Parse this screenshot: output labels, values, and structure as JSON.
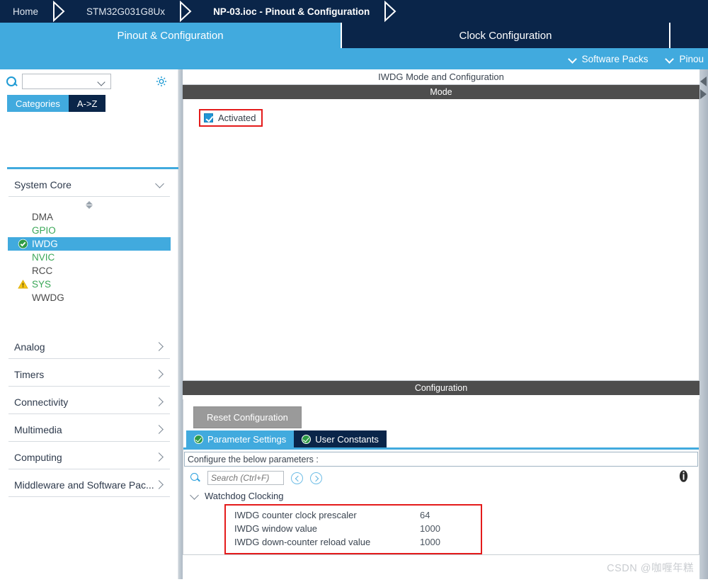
{
  "breadcrumb": {
    "items": [
      {
        "label": "Home",
        "active": false
      },
      {
        "label": "STM32G031G8Ux",
        "active": false
      },
      {
        "label": "NP-03.ioc - Pinout & Configuration",
        "active": true
      }
    ]
  },
  "tabs": [
    {
      "label": "Pinout & Configuration",
      "selected": true
    },
    {
      "label": "Clock Configuration",
      "selected": false
    }
  ],
  "subbar": {
    "software_packs": "Software Packs",
    "pinout": "Pinou"
  },
  "sidebar": {
    "search": {
      "value": "",
      "placeholder": ""
    },
    "gear_tooltip": "settings",
    "view_tabs": [
      {
        "label": "Categories",
        "selected": true
      },
      {
        "label": "A->Z",
        "selected": false
      }
    ],
    "groups": [
      {
        "label": "System Core",
        "expanded": true
      },
      {
        "label": "Analog",
        "expanded": false
      },
      {
        "label": "Timers",
        "expanded": false
      },
      {
        "label": "Connectivity",
        "expanded": false
      },
      {
        "label": "Multimedia",
        "expanded": false
      },
      {
        "label": "Computing",
        "expanded": false
      },
      {
        "label": "Middleware and Software Pac...",
        "expanded": false
      }
    ],
    "peripherals": [
      {
        "label": "DMA",
        "state": "plain",
        "icon": "none"
      },
      {
        "label": "GPIO",
        "state": "green",
        "icon": "none"
      },
      {
        "label": "IWDG",
        "state": "selected",
        "icon": "check-circle-icon"
      },
      {
        "label": "NVIC",
        "state": "green",
        "icon": "none"
      },
      {
        "label": "RCC",
        "state": "plain",
        "icon": "none"
      },
      {
        "label": "SYS",
        "state": "green",
        "icon": "warning-triangle-icon"
      },
      {
        "label": "WWDG",
        "state": "plain",
        "icon": "none"
      }
    ]
  },
  "main": {
    "panel_title": "IWDG Mode and Configuration",
    "mode_section": "Mode",
    "mode_checkbox": {
      "label": "Activated",
      "checked": true,
      "highlighted": true
    },
    "configuration_section": "Configuration",
    "reset_button": "Reset Configuration",
    "config_tabs": [
      {
        "label": "Parameter Settings",
        "selected": true
      },
      {
        "label": "User Constants",
        "selected": false
      }
    ],
    "configure_note": "Configure the below parameters :",
    "search": {
      "value": "",
      "placeholder": "Search (Ctrl+F)"
    },
    "group": {
      "label": "Watchdog Clocking",
      "expanded": true
    },
    "parameters": [
      {
        "name": "IWDG counter clock prescaler",
        "value": "64"
      },
      {
        "name": "IWDG window value",
        "value": "1000"
      },
      {
        "name": "IWDG down-counter reload value",
        "value": "1000"
      }
    ]
  },
  "watermark": "CSDN @咖喱年糕",
  "colors": {
    "navy": "#0a2549",
    "accent_blue": "#41aade",
    "section_gray": "#4d4d4d",
    "highlight_red": "#e41b1b",
    "green_text": "#3aa757",
    "warning_yellow": "#f5c518"
  }
}
